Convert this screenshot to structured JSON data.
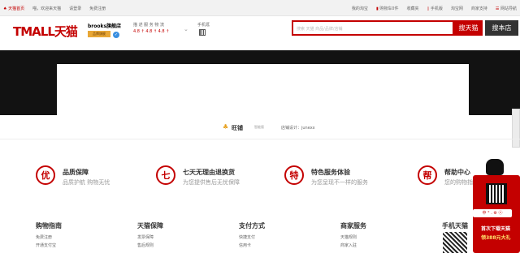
{
  "topbar": {
    "left": [
      "天猫首页",
      "喵，欢迎来天猫",
      "请登录",
      "免费注册"
    ],
    "right": [
      "我的淘宝",
      "购物车0件",
      "收藏夹",
      "手机版",
      "淘宝网",
      "商家支持",
      "网站导航"
    ]
  },
  "header": {
    "logo": "TMALL天猫",
    "shop_name": "brooks旗舰店",
    "shop_badge": "品牌旗舰",
    "rating_labels": "描 述  服 务  物 流",
    "rating_values": "4.8 ↑  4.8 ↑  4.8 ↑",
    "phone_label": "手机逛",
    "search_placeholder": "搜索 天猫 商品/品牌/店铺",
    "search_tmall_button": "搜天猫",
    "search_shop_button": "搜本店"
  },
  "wang": {
    "brand": "旺铺",
    "edition": "智能版",
    "designer": "店铺设计：junexx"
  },
  "sidebar_button": "",
  "services": [
    {
      "icon": "优",
      "title": "品质保障",
      "sub": "品质护航 购物无忧"
    },
    {
      "icon": "七",
      "title": "七天无理由退换货",
      "sub": "为您提供售后无忧保障"
    },
    {
      "icon": "特",
      "title": "特色服务体验",
      "sub": "为您呈现不一样的服务"
    },
    {
      "icon": "帮",
      "title": "帮助中心",
      "sub": "您的购物指南"
    }
  ],
  "footer": [
    {
      "title": "购物指南",
      "items": [
        "免费注册",
        "开通支付宝"
      ]
    },
    {
      "title": "天猫保障",
      "items": [
        "发票保障",
        "售后规则"
      ]
    },
    {
      "title": "支付方式",
      "items": [
        "快捷支付",
        "信用卡"
      ]
    },
    {
      "title": "商家服务",
      "items": [
        "天猫规则",
        "商家入驻"
      ]
    },
    {
      "title": "手机天猫",
      "items": []
    }
  ],
  "promo": {
    "tag": "中 ° . ⚙ ⓔ",
    "line1": "首次下载天猫",
    "line2": "领388元大礼"
  }
}
